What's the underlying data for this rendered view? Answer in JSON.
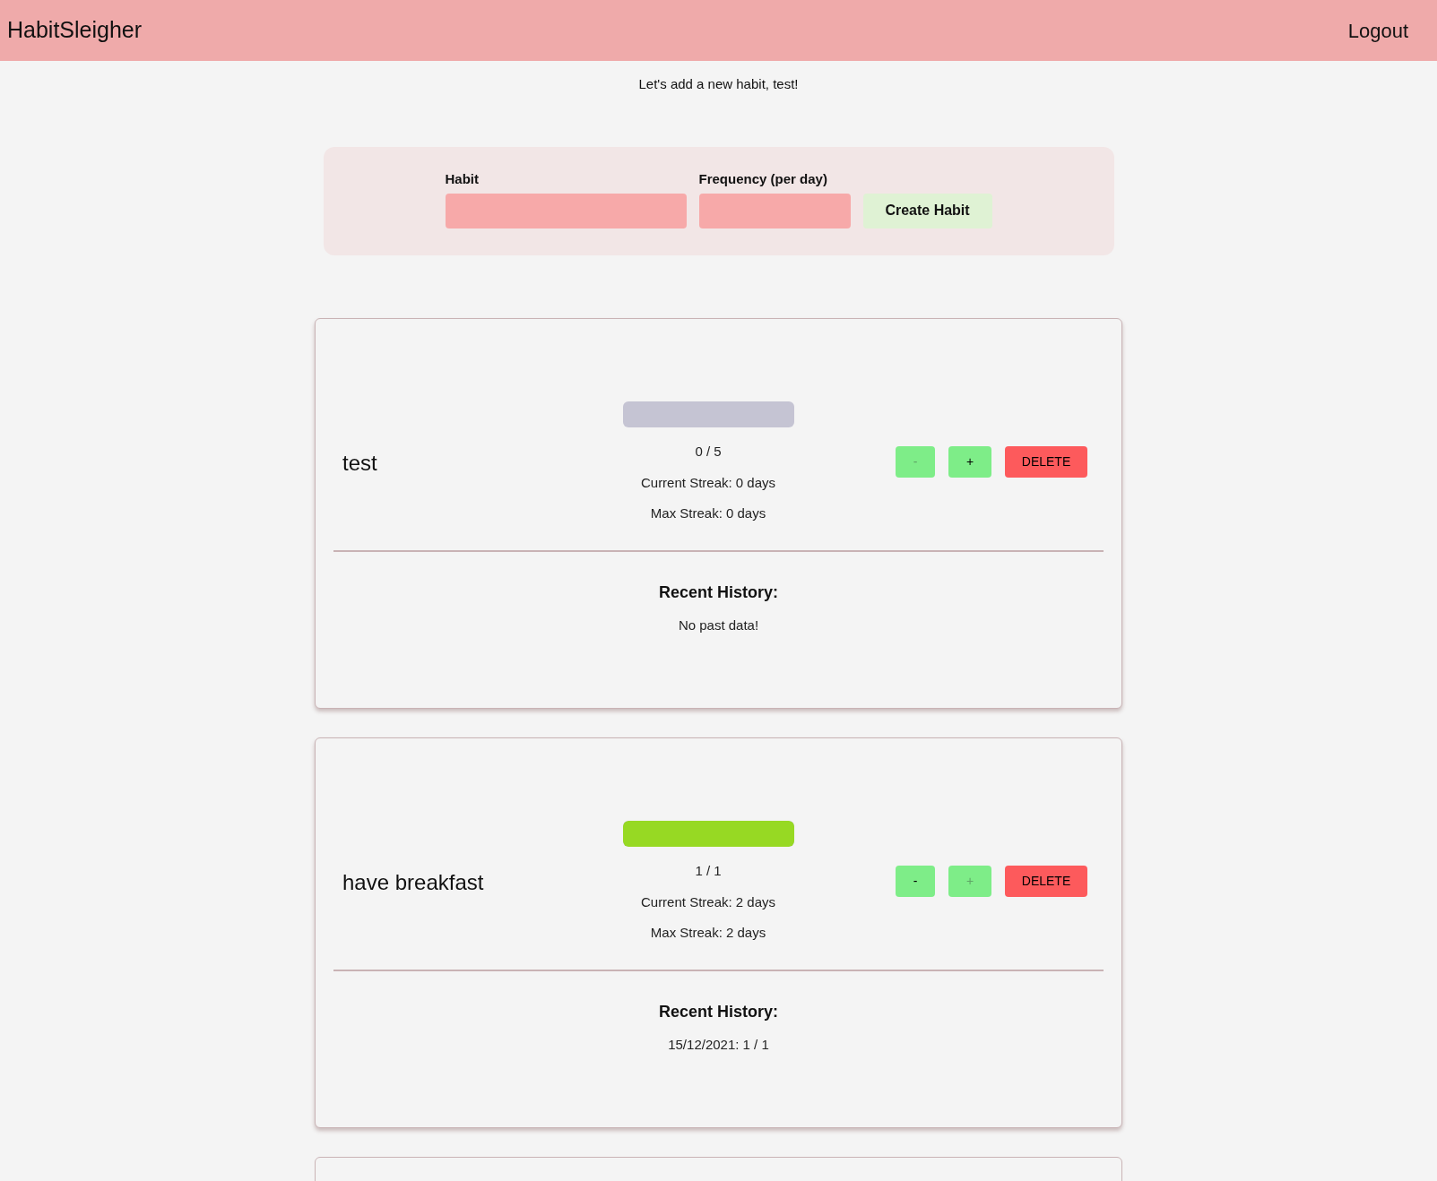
{
  "header": {
    "brand": "HabitSleigher",
    "logout": "Logout"
  },
  "greeting": "Let's add a new habit, test!",
  "form": {
    "habit_label": "Habit",
    "frequency_label": "Frequency (per day)",
    "submit": "Create Habit"
  },
  "habits": [
    {
      "name": "test",
      "level": 0,
      "count": "0 / 5",
      "current_streak": "Current Streak: 0 days",
      "max_streak": "Max Streak: 0 days",
      "minus": {
        "label": "-",
        "disabled": true
      },
      "plus": {
        "label": "+",
        "disabled": false
      },
      "delete": "DELETE",
      "history_title": "Recent History:",
      "history": [
        "No past data!"
      ]
    },
    {
      "name": "have breakfast",
      "level": 1,
      "count": "1 / 1",
      "current_streak": "Current Streak: 2 days",
      "max_streak": "Max Streak: 2 days",
      "minus": {
        "label": "-",
        "disabled": false
      },
      "plus": {
        "label": "+",
        "disabled": true
      },
      "delete": "DELETE",
      "history_title": "Recent History:",
      "history": [
        "15/12/2021: 1 / 1"
      ]
    }
  ]
}
